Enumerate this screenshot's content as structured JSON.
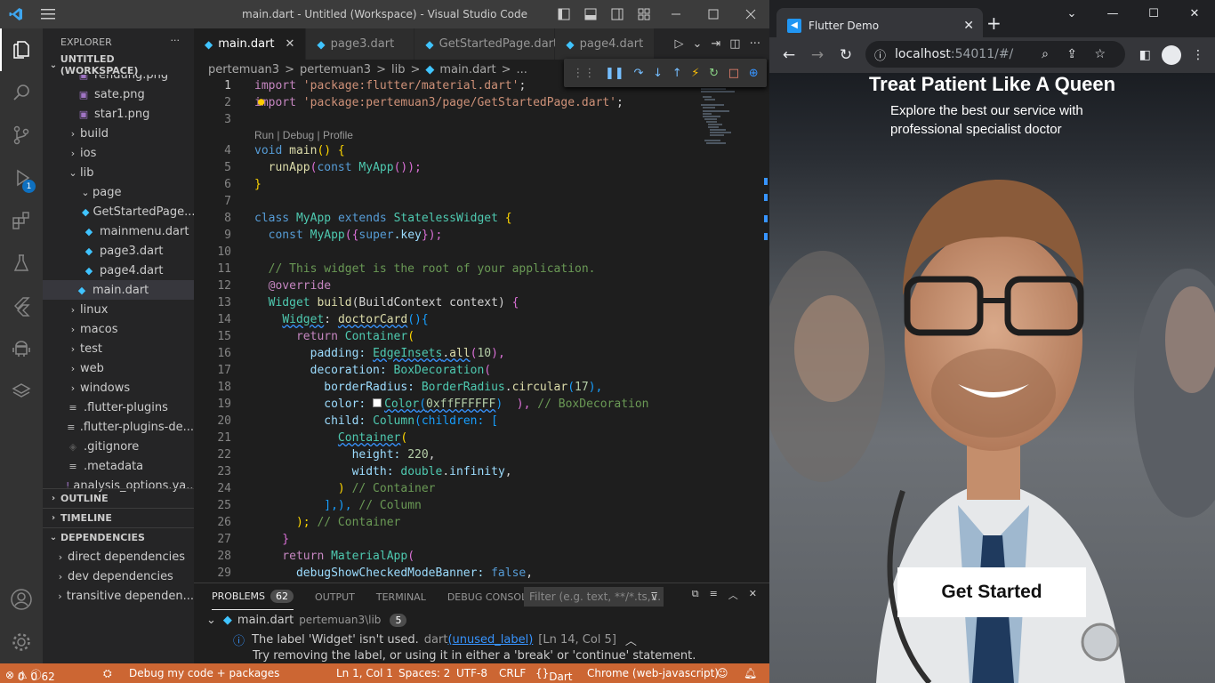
{
  "vscode": {
    "window_title": "main.dart - Untitled (Workspace) - Visual Studio Code",
    "explorer_title": "EXPLORER",
    "workspace": "UNTITLED (WORKSPACE)",
    "tree": [
      {
        "label": "rendung.png",
        "type": "file"
      },
      {
        "label": "sate.png",
        "type": "file"
      },
      {
        "label": "star1.png",
        "type": "file"
      },
      {
        "label": "build",
        "type": "folder"
      },
      {
        "label": "ios",
        "type": "folder"
      },
      {
        "label": "lib",
        "type": "folder-open"
      },
      {
        "label": "page",
        "type": "folder-open"
      },
      {
        "label": "GetStartedPage....",
        "type": "dart"
      },
      {
        "label": "mainmenu.dart",
        "type": "dart"
      },
      {
        "label": "page3.dart",
        "type": "dart"
      },
      {
        "label": "page4.dart",
        "type": "dart"
      },
      {
        "label": "main.dart",
        "type": "dart"
      },
      {
        "label": "linux",
        "type": "folder"
      },
      {
        "label": "macos",
        "type": "folder"
      },
      {
        "label": "test",
        "type": "folder"
      },
      {
        "label": "web",
        "type": "folder"
      },
      {
        "label": "windows",
        "type": "folder"
      },
      {
        "label": ".flutter-plugins",
        "type": "text"
      },
      {
        "label": ".flutter-plugins-de...",
        "type": "text"
      },
      {
        "label": ".gitignore",
        "type": "git"
      },
      {
        "label": ".metadata",
        "type": "text"
      },
      {
        "label": "analysis_options.ya...",
        "type": "yaml"
      }
    ],
    "sections": {
      "outline": "OUTLINE",
      "timeline": "TIMELINE",
      "dependencies": "DEPENDENCIES"
    },
    "deps": [
      "direct dependencies",
      "dev dependencies",
      "transitive dependen..."
    ],
    "tabs": [
      "main.dart",
      "page3.dart",
      "GetStartedPage.dart",
      "page4.dart"
    ],
    "breadcrumb": [
      "pertemuan3",
      ">",
      "pertemuan3",
      ">",
      "lib",
      ">",
      "main.dart",
      ">",
      "..."
    ],
    "code": {
      "l1a": "import ",
      "l1b": "'package:flutter/material.dart'",
      "l1c": ";",
      "l2a": "import ",
      "l2b": "'package:pertemuan3/page/GetStartedPage.dart'",
      "l2c": ";",
      "lens": "Run | Debug | Profile",
      "l4a": "void ",
      "l4b": "main",
      "l4c": "() {",
      "l5a": "  runApp",
      "l5b": "(",
      "l5c": "const ",
      "l5d": "MyApp",
      "l5e": "());",
      "l6": "}",
      "l8a": "class ",
      "l8b": "MyApp ",
      "l8c": "extends ",
      "l8d": "StatelessWidget ",
      "l8e": "{",
      "l9a": "  const ",
      "l9b": "MyApp",
      "l9c": "({",
      "l9d": "super",
      "l9e": ".key",
      "l9f": "});",
      "l11": "  // This widget is the root of your application.",
      "l12": "  @override",
      "l13a": "  Widget ",
      "l13b": "build",
      "l13c": "(BuildContext context) ",
      "l13d": "{",
      "l14a": "    ",
      "l14b": "Widget",
      "l14c": ": ",
      "l14d": "doctorCard",
      "l14e": "(){",
      "l15a": "      return ",
      "l15b": "Container",
      "l15c": "(",
      "l16a": "        padding: ",
      "l16b": "EdgeInsets",
      "l16c": ".",
      "l16d": "all",
      "l16e": "(",
      "l16f": "10",
      "l16g": "),",
      "l17a": "        decoration: ",
      "l17b": "BoxDecoration",
      "l17c": "(",
      "l18a": "          borderRadius: ",
      "l18b": "BorderRadius",
      "l18c": ".",
      "l18d": "circular",
      "l18e": "(",
      "l18f": "17",
      "l18g": "),",
      "l19a": "          color: ",
      "l19b": "Color",
      "l19c": "(",
      "l19d": "0xffFFFFFF",
      "l19e": ")  ",
      ")": ")",
      "l19f": "), ",
      "l19g": "// BoxDecoration",
      "l20a": "          child: ",
      "l20b": "Column",
      "l20c": "(children: [",
      "l21a": "            ",
      "l21b": "Container",
      "l21c": "(",
      "l22a": "              height: ",
      "l22b": "220",
      ",": ",",
      "l23a": "              width: ",
      "l23b": "double",
      "l23c": ".",
      "l23d": "infinity",
      ",2": ",",
      "l24a": "            ) ",
      "l24b": "// Container",
      "l25a": "          ],), ",
      "l25b": "// Column",
      "l26a": "      ); ",
      "l26b": "// Container",
      "l27": "    }",
      "l28a": "    return ",
      "l28b": "MaterialApp",
      "l28c": "(",
      "l29a": "      debugShowCheckedModeBanner: ",
      "l29b": "false",
      ",3": ","
    },
    "panel": {
      "tabs": [
        "PROBLEMS",
        "OUTPUT",
        "TERMINAL",
        "DEBUG CONSOLE"
      ],
      "count": "62",
      "filter_placeholder": "Filter (e.g. text, **/*.ts,...",
      "file": "main.dart",
      "path": "pertemuan3\\lib",
      "file_count": "5",
      "msg": "The label 'Widget' isn't used.",
      "msg_src": "dart",
      "msg_code": "(unused_label)",
      "msg_pos": "[Ln 14, Col 5]",
      "msg2": "Try removing the label, or using it in either a 'break' or 'continue' statement."
    },
    "status": {
      "errors": "0",
      "warnings": "0",
      "infos": "62",
      "debug": "Debug my code + packages",
      "pos": "Ln 1, Col 1",
      "spaces": "Spaces: 2",
      "enc": "UTF-8",
      "eol": "CRLF",
      "lang": "Dart",
      "device": "Chrome (web-javascript)"
    },
    "debug_badge": "1"
  },
  "browser": {
    "tab_title": "Flutter Demo",
    "url_host": "localhost",
    "url_rest": ":54011/#/",
    "app": {
      "title": "Treat Patient Like A Queen",
      "subtitle": "Explore the best our service with professional specialist doctor",
      "button": "Get Started"
    }
  },
  "colors": {
    "accent": "#0e70c0",
    "status": "#cc6633",
    "browser_bg": "#202124"
  }
}
